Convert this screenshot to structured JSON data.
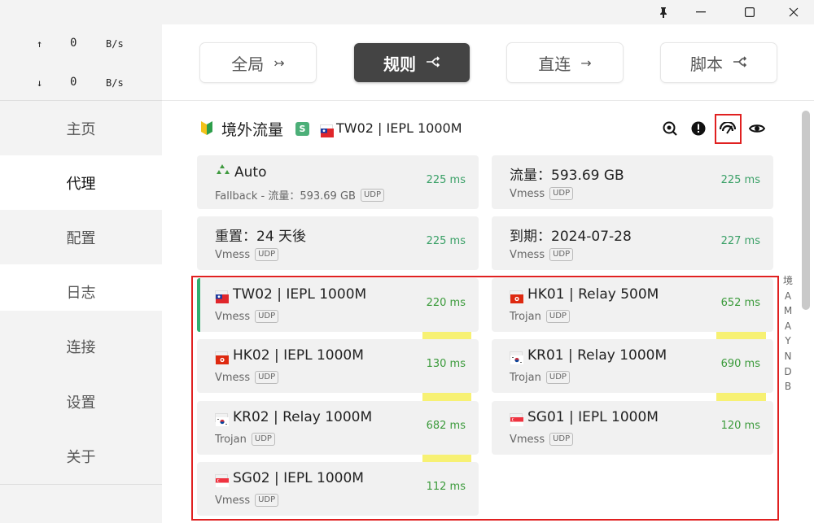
{
  "window": {
    "pin": "🖈",
    "minimize": "—",
    "maximize": "☐",
    "close": "✕"
  },
  "speed": {
    "up": {
      "arrow": "↑",
      "value": "0",
      "unit": "B/s"
    },
    "down": {
      "arrow": "↓",
      "value": "0",
      "unit": "B/s"
    }
  },
  "sidebar": {
    "items": [
      {
        "label": "主页"
      },
      {
        "label": "代理",
        "active": true
      },
      {
        "label": "配置"
      },
      {
        "label": "日志"
      },
      {
        "label": "连接"
      },
      {
        "label": "设置"
      },
      {
        "label": "关于"
      }
    ]
  },
  "modes": [
    {
      "label": "全局",
      "icon": "↣"
    },
    {
      "label": "规则",
      "icon": "⊰",
      "active": true
    },
    {
      "label": "直连",
      "icon": "→"
    },
    {
      "label": "脚本",
      "icon": "⊰"
    }
  ],
  "group": {
    "icon": "🔰",
    "title": "境外流量",
    "badge": "S",
    "selected": "TW02 | IEPL 1000M",
    "actions": [
      "location-search-icon",
      "alert-icon",
      "speed-test-icon",
      "eye-icon"
    ]
  },
  "proxies": [
    {
      "name": "Auto",
      "icon": "♻️",
      "sub": "Fallback - 流量：593.69 GB",
      "udp": "UDP",
      "ms": "225 ms"
    },
    {
      "name": "流量：593.69 GB",
      "sub": "Vmess",
      "udp": "UDP",
      "ms": "225 ms"
    },
    {
      "name": "重置：24 天後",
      "sub": "Vmess",
      "udp": "UDP",
      "ms": "225 ms"
    },
    {
      "name": "到期：2024-07-28",
      "sub": "Vmess",
      "udp": "UDP",
      "ms": "227 ms"
    },
    {
      "name": "TW02 | IEPL 1000M",
      "flag": "tw",
      "sub": "Vmess",
      "udp": "UDP",
      "ms": "220 ms",
      "selected": true
    },
    {
      "name": "HK01 | Relay 500M",
      "flag": "hk",
      "sub": "Trojan",
      "udp": "UDP",
      "ms": "652 ms"
    },
    {
      "name": "HK02 | IEPL 1000M",
      "flag": "hk",
      "sub": "Vmess",
      "udp": "UDP",
      "ms": "130 ms"
    },
    {
      "name": "KR01 | Relay 1000M",
      "flag": "kr",
      "sub": "Trojan",
      "udp": "UDP",
      "ms": "690 ms"
    },
    {
      "name": "KR02 | Relay 1000M",
      "flag": "kr",
      "sub": "Trojan",
      "udp": "UDP",
      "ms": "682 ms"
    },
    {
      "name": "SG01 | IEPL 1000M",
      "flag": "sg",
      "sub": "Vmess",
      "udp": "UDP",
      "ms": "120 ms"
    },
    {
      "name": "SG02 | IEPL 1000M",
      "flag": "sg",
      "sub": "Vmess",
      "udp": "UDP",
      "ms": "112 ms"
    }
  ],
  "index": [
    "境",
    "A",
    "M",
    "A",
    "Y",
    "N",
    "D",
    "B"
  ],
  "colors": {
    "accent_green": "#2eaf70",
    "latency_green": "#3aa067",
    "annotation_red": "#e02020",
    "highlight_yellow": "#f6ee5b"
  }
}
